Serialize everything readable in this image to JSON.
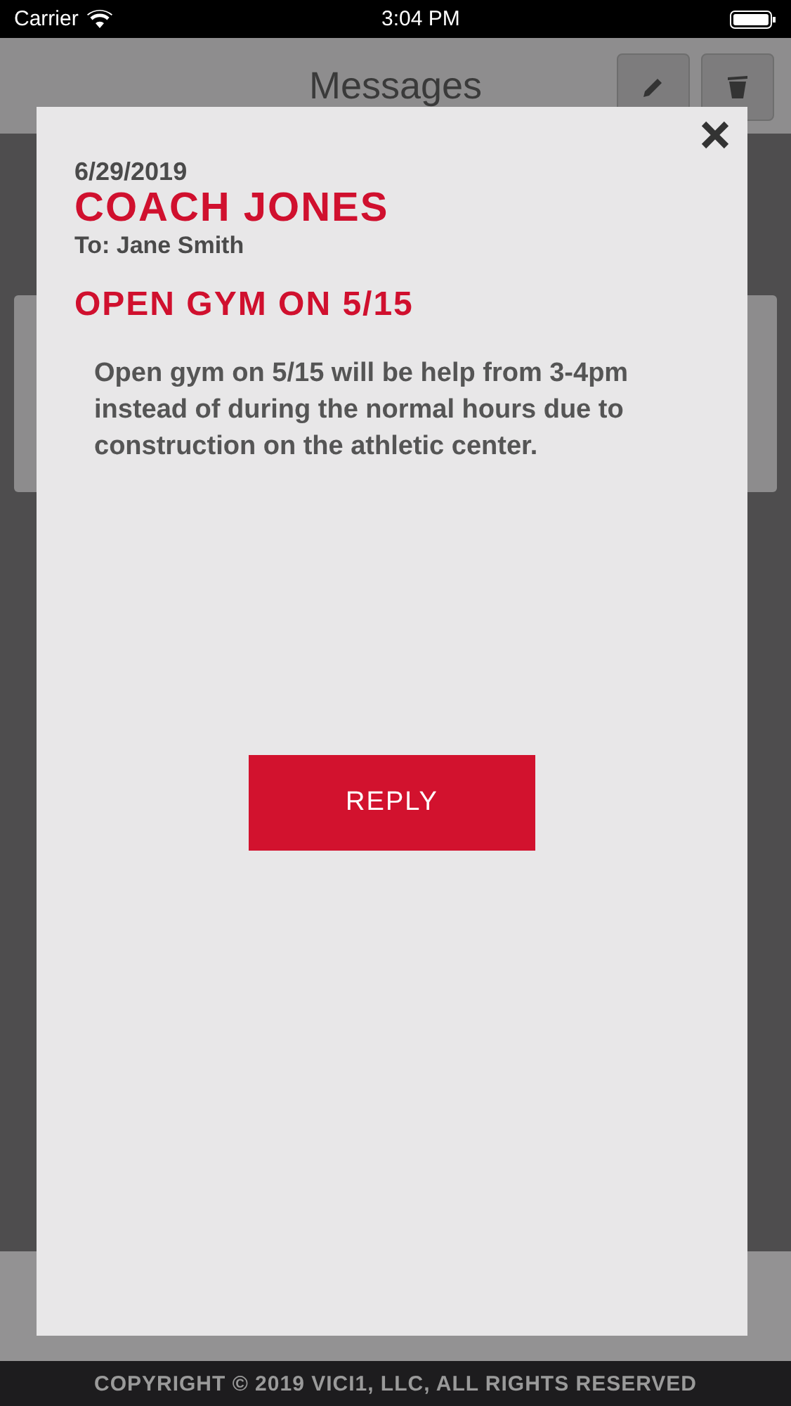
{
  "status_bar": {
    "carrier": "Carrier",
    "time": "3:04 PM"
  },
  "header": {
    "title": "Messages"
  },
  "dialog": {
    "date": "6/29/2019",
    "sender": "COACH JONES",
    "recipient": "To: Jane Smith",
    "subject": "OPEN GYM ON 5/15",
    "body": "Open gym on 5/15 will be help from 3-4pm instead of during the normal hours due to construction on the athletic center.",
    "reply_button": "REPLY"
  },
  "footer": {
    "copyright": "COPYRIGHT © 2019 VICI1, LLC, ALL RIGHTS RESERVED"
  }
}
